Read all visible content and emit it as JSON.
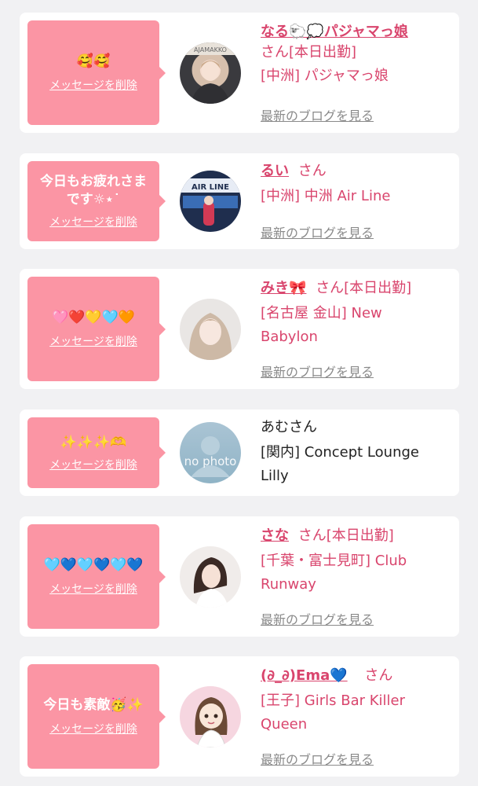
{
  "delete_label": "メッセージを削除",
  "blog_label": "最新のブログを見る",
  "cards": [
    {
      "message": "🥰🥰",
      "name": "なる🐑💭パジャマっ娘",
      "suffix": "さん[本日出勤]",
      "shop": "[中洲] パジャマっ娘",
      "avatar_text": "AJAMAKKO"
    },
    {
      "message": "今日もお疲れさま\nです☼⋆˙",
      "name": "るい",
      "suffix": "さん",
      "shop": "[中洲] 中洲 Air Line",
      "avatar_text": "AIR LINE"
    },
    {
      "message": "🩷❤️💛🩵🧡",
      "name": "みき🎀",
      "suffix": "さん[本日出勤]",
      "shop": "[名古屋 金山] New Babylon",
      "avatar_text": ""
    },
    {
      "message": "✨✨✨🫶",
      "name": "あむさん",
      "suffix": "",
      "shop": "[関内] Concept Lounge Lilly",
      "avatar_text": "no photo"
    },
    {
      "message": "🩵💙🩵💙🩵💙",
      "name": "さな",
      "suffix": "さん[本日出勤]",
      "shop": "[千葉・富士見町] Club Runway",
      "avatar_text": ""
    },
    {
      "message": "今日も素敵🥳✨",
      "name": "(∂_∂)Ema💙",
      "suffix": "さん",
      "shop": "[王子] Girls Bar Killer Queen",
      "avatar_text": ""
    }
  ]
}
